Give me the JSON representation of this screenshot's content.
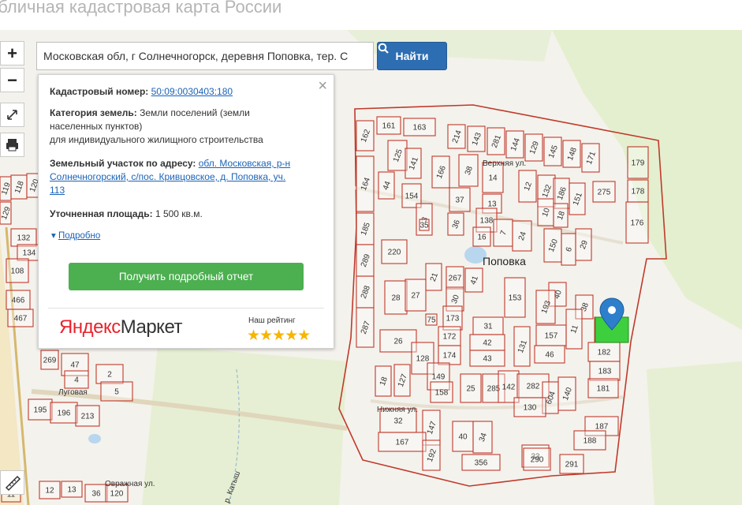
{
  "page": {
    "title": "убличная кадастровая карта России"
  },
  "controls": {
    "zoom_in": "+",
    "zoom_out": "−"
  },
  "search": {
    "value": "Московская обл, г Солнечногорск, деревня Поповка, тер. С",
    "button_label": "Найти"
  },
  "popup": {
    "close": "×",
    "cadastral_label": "Кадастровый номер:",
    "cadastral_value": "50:09:0030403:180",
    "category_label": "Категория земель:",
    "category_value_1": "Земли поселений (земли",
    "category_value_2": "населенных пунктов)",
    "category_value_3": "для индивидуального жилищного строительства",
    "address_label": "Земельный участок по адресу:",
    "address_value_1": "обл. Московская, р-н",
    "address_value_2": "Солнечногорский, с/пос. Кривцовское, д. Поповка, уч.",
    "address_value_3": "113",
    "area_label": "Уточненная площадь:",
    "area_value": "1 500 кв.м.",
    "more_link": "Подробно",
    "report_button": "Получить подробный отчет",
    "ad_brand_y": "Яндекс",
    "ad_brand_rest": "Маркет",
    "ad_rating_label": "Наш рейтинг",
    "ad_stars": "★★★★★"
  },
  "map": {
    "village_label": "Поповка",
    "streets": [
      "Верхняя ул.",
      "Нижняя ул.",
      "Луговая",
      "Овражная ул.",
      "р. Катыш"
    ],
    "plots": [
      {
        "id": "161"
      },
      {
        "id": "163"
      },
      {
        "id": "214"
      },
      {
        "id": "143"
      },
      {
        "id": "281"
      },
      {
        "id": "144"
      },
      {
        "id": "129"
      },
      {
        "id": "145"
      },
      {
        "id": "148"
      },
      {
        "id": "171"
      },
      {
        "id": "179"
      },
      {
        "id": "162"
      },
      {
        "id": "125"
      },
      {
        "id": "141"
      },
      {
        "id": "166"
      },
      {
        "id": "38"
      },
      {
        "id": "14"
      },
      {
        "id": "12"
      },
      {
        "id": "132"
      },
      {
        "id": "186"
      },
      {
        "id": "151"
      },
      {
        "id": "275"
      },
      {
        "id": "178"
      },
      {
        "id": "164"
      },
      {
        "id": "44"
      },
      {
        "id": "154"
      },
      {
        "id": "37"
      },
      {
        "id": "13"
      },
      {
        "id": "10"
      },
      {
        "id": "18"
      },
      {
        "id": "185"
      },
      {
        "id": "3"
      },
      {
        "id": "35"
      },
      {
        "id": "36"
      },
      {
        "id": "138"
      },
      {
        "id": "16"
      },
      {
        "id": "7"
      },
      {
        "id": "24"
      },
      {
        "id": "176"
      },
      {
        "id": "289"
      },
      {
        "id": "220"
      },
      {
        "id": "150"
      },
      {
        "id": "6"
      },
      {
        "id": "29"
      },
      {
        "id": "288"
      },
      {
        "id": "21"
      },
      {
        "id": "267"
      },
      {
        "id": "41"
      },
      {
        "id": "153"
      },
      {
        "id": "40"
      },
      {
        "id": "287"
      },
      {
        "id": "28"
      },
      {
        "id": "27"
      },
      {
        "id": "30"
      },
      {
        "id": "193"
      },
      {
        "id": "38"
      },
      {
        "id": "75"
      },
      {
        "id": "173"
      },
      {
        "id": "31"
      },
      {
        "id": "157"
      },
      {
        "id": "11"
      },
      {
        "id": "180"
      },
      {
        "id": "26"
      },
      {
        "id": "172"
      },
      {
        "id": "42"
      },
      {
        "id": "131"
      },
      {
        "id": "46"
      },
      {
        "id": "182"
      },
      {
        "id": "128"
      },
      {
        "id": "174"
      },
      {
        "id": "43"
      },
      {
        "id": "183"
      },
      {
        "id": "18"
      },
      {
        "id": "127"
      },
      {
        "id": "149"
      },
      {
        "id": "25"
      },
      {
        "id": "285"
      },
      {
        "id": "142"
      },
      {
        "id": "282"
      },
      {
        "id": "181"
      },
      {
        "id": "158"
      },
      {
        "id": "604"
      },
      {
        "id": "140"
      },
      {
        "id": "130"
      },
      {
        "id": "32"
      },
      {
        "id": "147"
      },
      {
        "id": "187"
      },
      {
        "id": "167"
      },
      {
        "id": "40"
      },
      {
        "id": "34"
      },
      {
        "id": "33"
      },
      {
        "id": "188"
      },
      {
        "id": "192"
      },
      {
        "id": "356"
      },
      {
        "id": "290"
      },
      {
        "id": "291"
      },
      {
        "id": "119"
      },
      {
        "id": "118"
      },
      {
        "id": "120"
      },
      {
        "id": "129"
      },
      {
        "id": "132"
      },
      {
        "id": "134"
      },
      {
        "id": "108"
      },
      {
        "id": "466"
      },
      {
        "id": "467"
      },
      {
        "id": "269"
      },
      {
        "id": "47"
      },
      {
        "id": "2"
      },
      {
        "id": "4"
      },
      {
        "id": "5"
      },
      {
        "id": "195"
      },
      {
        "id": "196"
      },
      {
        "id": "213"
      },
      {
        "id": "12"
      },
      {
        "id": "13"
      },
      {
        "id": "36"
      },
      {
        "id": "120"
      },
      {
        "id": "11"
      }
    ]
  },
  "colors": {
    "boundary": "#c0392b",
    "selected": "#3ecf3e",
    "pin": "#2d7fcc",
    "search_button": "#2d6db2",
    "report_button": "#4caf50"
  }
}
